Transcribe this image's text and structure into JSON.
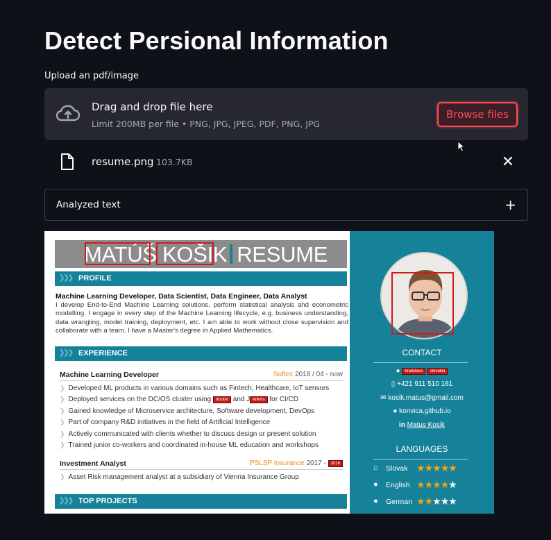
{
  "page": {
    "title": "Detect Persional Information",
    "upload_label": "Upload an pdf/image"
  },
  "dropzone": {
    "icon": "cloud-upload-icon",
    "title": "Drag and drop file here",
    "subtitle": "Limit 200MB per file • PNG, JPG, JPEG, PDF, PNG, JPG",
    "browse_label": "Browse files"
  },
  "file": {
    "name": "resume.png",
    "size": "103.7KB",
    "close_glyph": "✕"
  },
  "expander": {
    "label": "Analyzed text",
    "toggle_glyph": "+"
  },
  "resume": {
    "header": {
      "first": "MATÚŠ",
      "last": "KOŠIK",
      "word": "RESUME"
    },
    "sections": {
      "profile": "PROFILE",
      "experience": "EXPERIENCE",
      "projects": "TOP PROJECTS",
      "contact": "CONTACT",
      "languages": "LANGUAGES"
    },
    "profile": {
      "roles": "Machine Learning Developer, Data Scientist, Data Engineer, Data Analyst",
      "text": "I develop End-to-End Machine Learning solutions, perform statistical analysis and econometric modelling. I engage in every step of the Machine Learning lifecycle, e.g. business understanding, data wrangling, model training, deployment, etc. I am able to work without close supervision and collaborate with a team. I have a Master's degree in Applied Mathematics."
    },
    "jobs": [
      {
        "title": "Machine Learning Developer",
        "org": "Softec",
        "period": "2018 / 04 - now",
        "bullets": [
          {
            "pre": "Developed ML products in various domains such as Fintech, Healthcare, IoT sensors"
          },
          {
            "pre": "Deployed services on the DC/OS cluster using ",
            "tag1": "docker",
            "mid": " and J",
            "tag2": "enkins",
            "post": " for CI/CD"
          },
          {
            "pre": "Gained knowledge of Microservice architecture, Software development, DevOps"
          },
          {
            "pre": "Part of company R&D initiatives in the field of Artificial Intelligence"
          },
          {
            "pre": "Actively communicated with clients whether to discuss design or present solution"
          },
          {
            "pre": "Trained junior co-workers and coordinated in-house ML education and workshops"
          }
        ]
      },
      {
        "title": "Investment Analyst",
        "org": "PSLSP Insurance",
        "period": "2017 - ",
        "period_tag": "2018",
        "bullets": [
          {
            "pre": "Asset Risk management analyst at a subsidiary of Vienna Insurance Group"
          }
        ]
      }
    ],
    "contact": {
      "location_tags": [
        "bratislava",
        "slovakia"
      ],
      "phone": "+421 911 510 161",
      "email": "kosik.matus@gmail.com",
      "website": "konvica.github.io",
      "linkedin_prefix": "in",
      "linkedin": "Matus Kosik"
    },
    "languages": [
      {
        "name": "Slovak",
        "icon": "home-icon",
        "level": 5
      },
      {
        "name": "English",
        "icon": "chat-icon",
        "level": 4
      },
      {
        "name": "German",
        "icon": "chat-icon",
        "level": 2
      }
    ],
    "colors": {
      "teal": "#16829a",
      "redact": "#d11a1a",
      "star": "#f0a21a",
      "accent": "#ff4b4b"
    }
  }
}
